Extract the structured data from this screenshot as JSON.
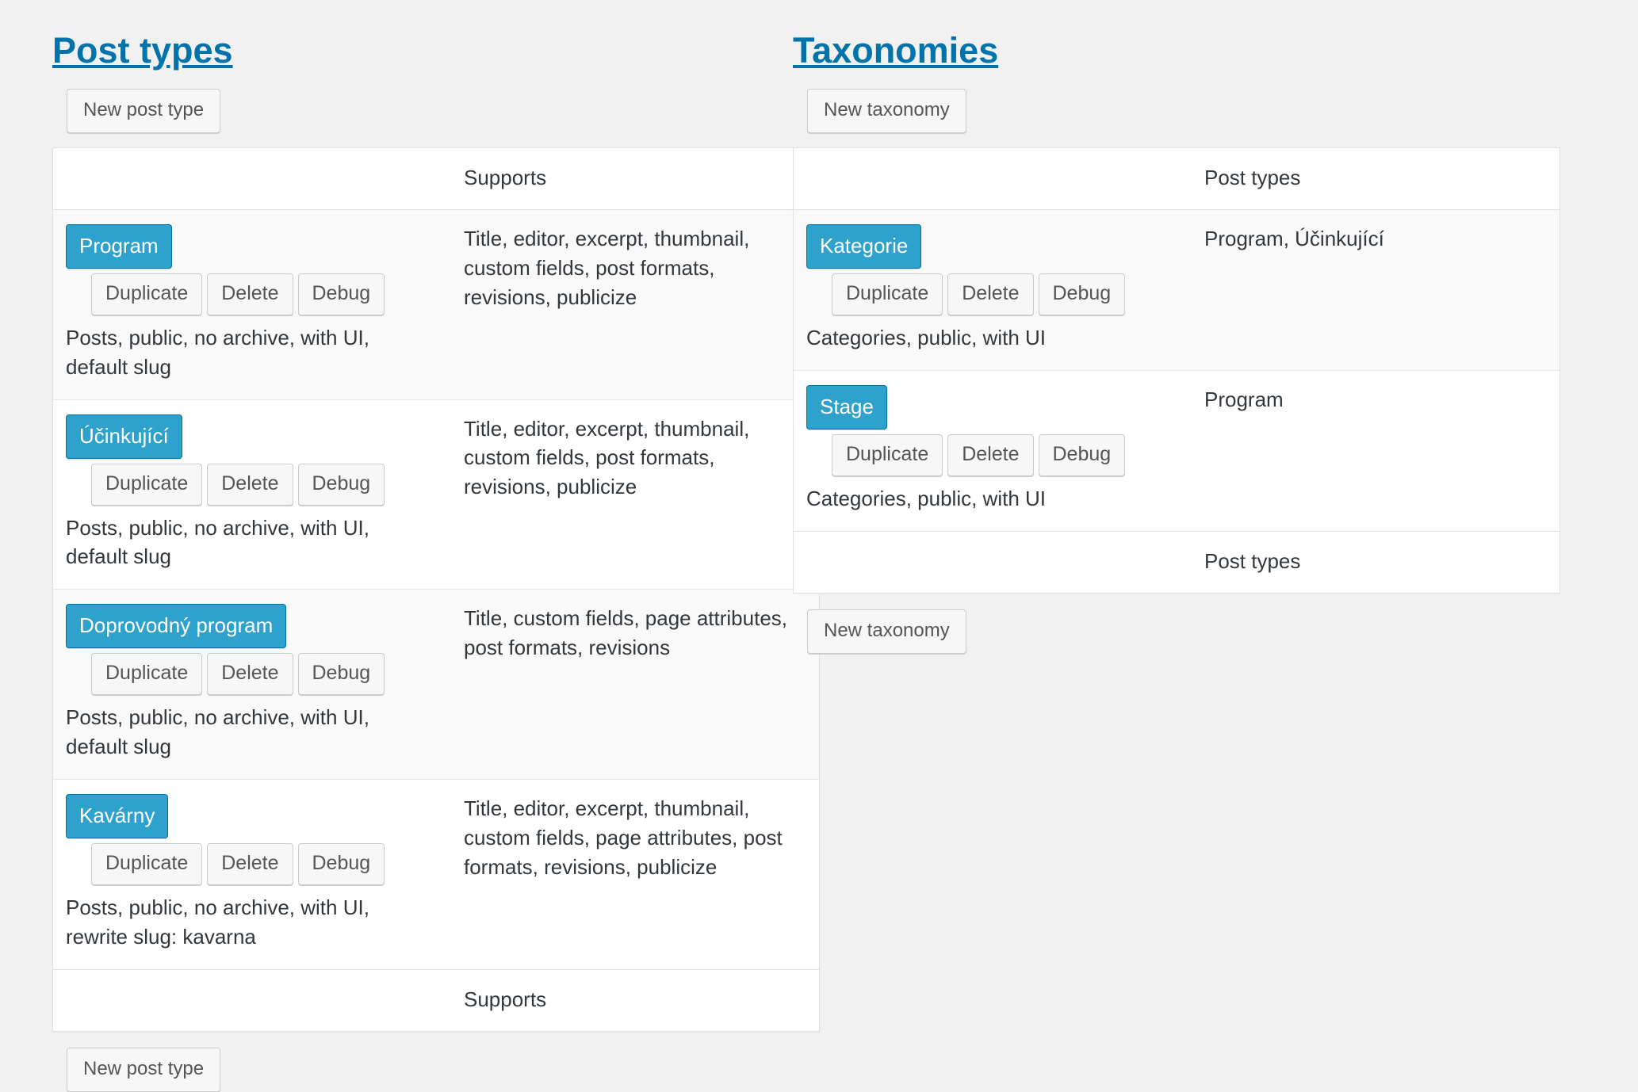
{
  "post_types": {
    "heading": "Post types",
    "new_button_top": "New post type",
    "new_button_bottom": "New post type",
    "columns": {
      "name": "",
      "supports": "Supports"
    },
    "footer_columns": {
      "name": "",
      "supports": "Supports"
    },
    "rows": [
      {
        "name": "Program",
        "actions": [
          "Duplicate",
          "Delete",
          "Debug"
        ],
        "description": "Posts, public, no archive, with UI, default slug",
        "supports": "Title, editor, excerpt, thumbnail, custom fields, post formats, revisions, publicize"
      },
      {
        "name": "Účinkující",
        "actions": [
          "Duplicate",
          "Delete",
          "Debug"
        ],
        "description": "Posts, public, no archive, with UI, default slug",
        "supports": "Title, editor, excerpt, thumbnail, custom fields, post formats, revisions, publicize"
      },
      {
        "name": "Doprovodný program",
        "actions": [
          "Duplicate",
          "Delete",
          "Debug"
        ],
        "description": "Posts, public, no archive, with UI, default slug",
        "supports": "Title, custom fields, page attributes, post formats, revisions"
      },
      {
        "name": "Kavárny",
        "actions": [
          "Duplicate",
          "Delete",
          "Debug"
        ],
        "description": "Posts, public, no archive, with UI, rewrite slug: kavarna",
        "supports": "Title, editor, excerpt, thumbnail, custom fields, page attributes, post formats, revisions, publicize"
      }
    ]
  },
  "taxonomies": {
    "heading": "Taxonomies",
    "new_button_top": "New taxonomy",
    "new_button_bottom": "New taxonomy",
    "columns": {
      "name": "",
      "post_types": "Post types"
    },
    "footer_columns": {
      "name": "",
      "post_types": "Post types"
    },
    "rows": [
      {
        "name": "Kategorie",
        "actions": [
          "Duplicate",
          "Delete",
          "Debug"
        ],
        "description": "Categories, public, with UI",
        "post_types": "Program, Účinkující"
      },
      {
        "name": "Stage",
        "actions": [
          "Duplicate",
          "Delete",
          "Debug"
        ],
        "description": "Categories, public, with UI",
        "post_types": "Program"
      }
    ]
  },
  "colors": {
    "accent_link": "#0073aa",
    "badge_bg": "#2ea2cc",
    "badge_border": "#0074a2",
    "page_bg": "#f1f1f1",
    "row_alt_bg": "#f9f9f9"
  }
}
